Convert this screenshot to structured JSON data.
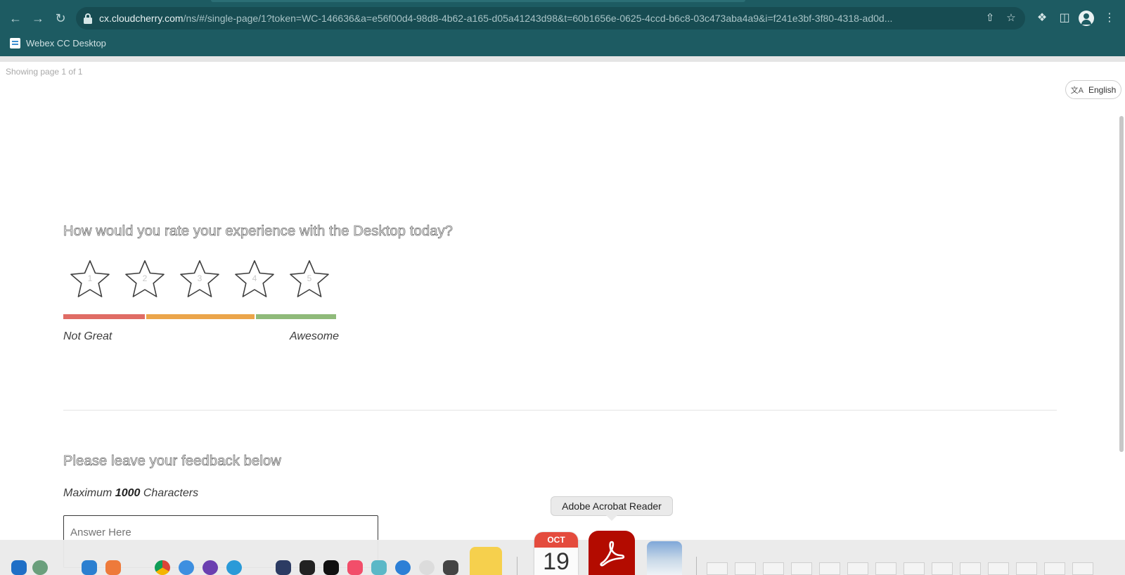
{
  "browser": {
    "url_host": "cx.cloudcherry.com",
    "url_rest": "/ns/#/single-page/1?token=WC-146636&a=e56f00d4-98d8-4b62-a165-d05a41243d98&t=60b1656e-0625-4ccd-b6c8-03c473aba4a9&i=f241e3bf-3f80-4318-ad0d...",
    "bookmark_label": "Webex CC Desktop"
  },
  "page": {
    "page_count": "Showing page 1 of 1",
    "language": "English"
  },
  "rating": {
    "question": "How would you rate your experience with the Desktop today?",
    "stars": [
      "1",
      "2",
      "3",
      "4",
      "5"
    ],
    "low_label": "Not Great",
    "high_label": "Awesome",
    "scale_colors": [
      "#e06c65",
      "#eba54a",
      "#8fba7a"
    ]
  },
  "feedback": {
    "question": "Please leave your feedback below",
    "max_prefix": "Maximum",
    "max_value": "1000",
    "max_suffix": "Characters",
    "placeholder": "Answer Here"
  },
  "dock": {
    "tooltip": "Adobe Acrobat Reader",
    "calendar_month": "OCT",
    "calendar_day": "19"
  }
}
